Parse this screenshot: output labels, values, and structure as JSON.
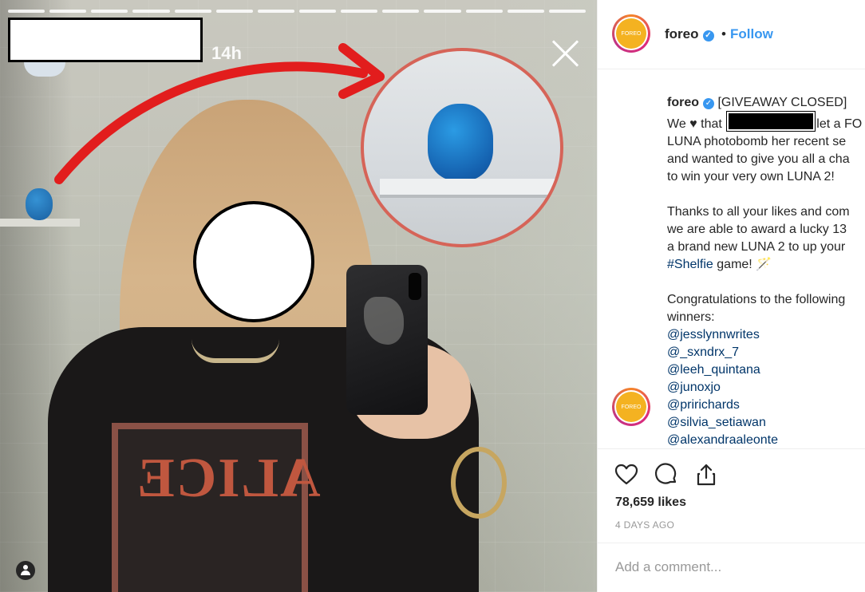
{
  "story": {
    "time": "14h"
  },
  "post": {
    "username": "foreo",
    "verified_mark": "✓",
    "separator": "•",
    "follow_label": "Follow",
    "avatar_brand": "FOREO",
    "caption": {
      "username": "foreo",
      "tag": "[GIVEAWAY CLOSED]",
      "line1_a": "We",
      "line1_b": "that",
      "line1_c": "let a FO",
      "line2": "LUNA photobomb her recent se",
      "line3": "and wanted to give you all a cha",
      "line4": "to win your very own LUNA 2!",
      "p2_line1": "Thanks to all your likes and com",
      "p2_line2": "we are able to award a lucky 13",
      "p2_line3": "a brand new LUNA 2 to up your",
      "hashtag": "#Shelfie",
      "hashtag_tail": "game! 🪄",
      "p3_line1": "Congratulations to the following",
      "p3_line2": "winners:",
      "winners": [
        "@jesslynnwrites",
        "@_sxndrx_7",
        "@leeh_quintana",
        "@junoxjo",
        "@pririchards",
        "@silvia_setiawan",
        "@alexandraaleonte"
      ]
    },
    "likes": "78,659 likes",
    "time_ago": "4 DAYS AGO",
    "comment_placeholder": "Add a comment..."
  },
  "icons": {
    "heart": "heart-icon",
    "comment": "comment-icon",
    "share": "share-icon",
    "close": "close-icon",
    "user_tag": "user-tag-icon",
    "verified": "verified-badge-icon"
  },
  "colors": {
    "accent_blue": "#3897f0",
    "link_blue": "#003569",
    "arrow_red": "#e21d1d",
    "brand_yellow": "#f4b221"
  }
}
